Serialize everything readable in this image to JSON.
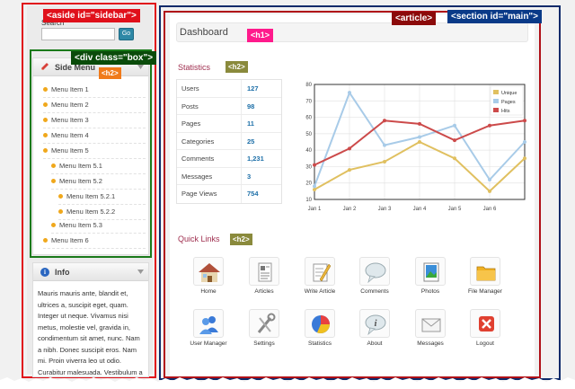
{
  "tags": {
    "sidebar": "<aside id=\"sidebar\">",
    "article": "<article>",
    "main": "<section id=\"main\">",
    "box": "<div class=\"box\">",
    "h1": "<h1>",
    "h2_side": "<h2>",
    "h2_stats": "<h2>",
    "h2_quick": "<h2>"
  },
  "sidebar": {
    "search_label": "Search",
    "search_value": "",
    "search_button": "Go",
    "side_menu_title": "Side Menu",
    "menu_items": [
      "Menu Item 1",
      "Menu Item 2",
      "Menu Item 3",
      "Menu Item 4",
      "Menu Item 5",
      "Menu Item 5.1",
      "Menu Item 5.2",
      "Menu Item 5.2.1",
      "Menu Item 5.2.2",
      "Menu Item 5.3",
      "Menu Item 6"
    ],
    "info_title": "Info",
    "info_text": "Mauris mauris ante, blandit et, ultrices a, suscipit eget, quam. Integer ut neque. Vivamus nisi metus, molestie vel, gravida in, condimentum sit amet, nunc. Nam a nibh. Donec suscipit eros. Nam mi. Proin viverra leo ut odio. Curabitur malesuada. Vestibulum a"
  },
  "main": {
    "page_title": "Dashboard",
    "statistics_title": "Statistics",
    "stats": [
      {
        "label": "Users",
        "value": "127"
      },
      {
        "label": "Posts",
        "value": "98"
      },
      {
        "label": "Pages",
        "value": "11"
      },
      {
        "label": "Categories",
        "value": "25"
      },
      {
        "label": "Comments",
        "value": "1,231"
      },
      {
        "label": "Messages",
        "value": "3"
      },
      {
        "label": "Page Views",
        "value": "754"
      }
    ],
    "quick_links_title": "Quick Links",
    "quick_links": [
      {
        "label": "Home",
        "icon": "home-icon"
      },
      {
        "label": "Articles",
        "icon": "articles-icon"
      },
      {
        "label": "Write Article",
        "icon": "write-article-icon"
      },
      {
        "label": "Comments",
        "icon": "comments-icon"
      },
      {
        "label": "Photos",
        "icon": "photos-icon"
      },
      {
        "label": "File Manager",
        "icon": "folder-icon"
      },
      {
        "label": "User Manager",
        "icon": "users-icon"
      },
      {
        "label": "Settings",
        "icon": "settings-icon"
      },
      {
        "label": "Statistics",
        "icon": "statistics-icon"
      },
      {
        "label": "About",
        "icon": "about-icon"
      },
      {
        "label": "Messages",
        "icon": "messages-icon"
      },
      {
        "label": "Logout",
        "icon": "logout-icon"
      }
    ]
  },
  "chart_data": {
    "type": "line",
    "categories": [
      "Jan 1",
      "Jan 2",
      "Jan 3",
      "Jan 4",
      "Jan 5",
      "Jan 6",
      ""
    ],
    "ylim": [
      10,
      80
    ],
    "yticks": [
      10,
      20,
      30,
      40,
      50,
      60,
      70,
      80
    ],
    "grid": true,
    "legend_position": "top-right",
    "series": [
      {
        "name": "Unique",
        "color": "#e0c060",
        "values": [
          16,
          28,
          33,
          45,
          35,
          15,
          35
        ]
      },
      {
        "name": "Pages",
        "color": "#a8cbe8",
        "values": [
          18,
          75,
          43,
          48,
          55,
          22,
          45
        ]
      },
      {
        "name": "Hits",
        "color": "#cc4a4a",
        "values": [
          31,
          41,
          58,
          56,
          46,
          55,
          58
        ]
      }
    ]
  },
  "colors": {
    "sidebar_outline": "#e0101a",
    "article_outline": "#8b0a0a",
    "main_outline": "#0a3a88",
    "box_outline": "#0a4b0a",
    "accent_link": "#1d6fa8",
    "section_title": "#a03050"
  }
}
